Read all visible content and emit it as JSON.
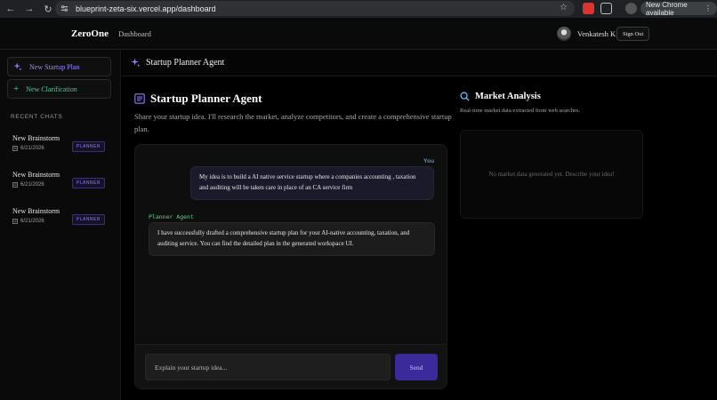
{
  "browser": {
    "url": "blueprint-zeta-six.vercel.app/dashboard",
    "update_label": "New Chrome available"
  },
  "header": {
    "logo": "ZeroOne",
    "nav_dashboard": "Dashboard",
    "user_name": "Venkatesh K",
    "sign_out": "Sign Out"
  },
  "sidebar": {
    "new_plan": "New Startup Plan",
    "new_clarification": "New Clarification",
    "recent_label": "RECENT CHATS",
    "chats": [
      {
        "title": "New Brainstorm",
        "date": "6/21/2026",
        "badge": "PLANNER"
      },
      {
        "title": "New Brainstorm",
        "date": "6/21/2026",
        "badge": "PLANNER"
      },
      {
        "title": "New Brainstorm",
        "date": "6/21/2026",
        "badge": "PLANNER"
      }
    ]
  },
  "main": {
    "header_title": "Startup Planner Agent",
    "agent_title": "Startup Planner Agent",
    "agent_desc": "Share your startup idea. I'll research the market, analyze competitors, and create a comprehensive startup plan.",
    "messages": {
      "user_label": "You",
      "user_text": "My idea is to build a AI native service startup where a companies accounting , taxation and auditing will be taken care in place of an CA service firm",
      "agent_label": "Planner Agent",
      "agent_text": "I have successfully drafted a comprehensive startup plan for your AI-native accounting, taxation, and auditing service. You can find the detailed plan in the generated workspace UI."
    },
    "input_placeholder": "Explain your startup idea...",
    "send_label": "Send"
  },
  "market": {
    "title": "Market Analysis",
    "subtitle": "Real-time market data extracted from web searches.",
    "empty": "No market data generated yet. Describe your idea!"
  },
  "colors": {
    "accent": "#8b7cff",
    "clarify": "#34d399",
    "send_bg": "#3a2a9a"
  }
}
